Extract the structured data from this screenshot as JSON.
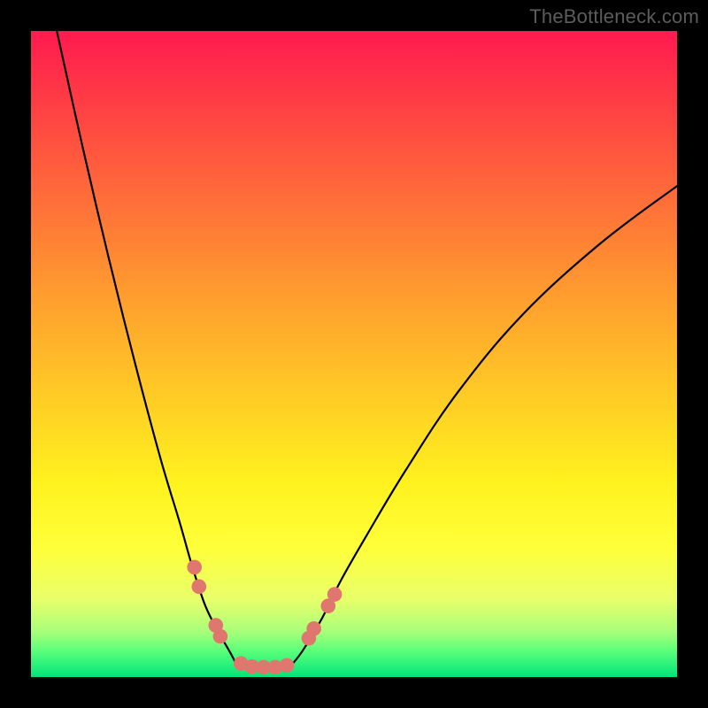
{
  "watermark": "TheBottleneck.com",
  "chart_data": {
    "type": "line",
    "title": "",
    "xlabel": "",
    "ylabel": "",
    "xlim": [
      0,
      100
    ],
    "ylim": [
      0,
      100
    ],
    "grid": false,
    "legend": false,
    "background_gradient": {
      "orientation": "vertical",
      "stops": [
        {
          "pos": 0.0,
          "color": "#ff1a4f"
        },
        {
          "pos": 0.25,
          "color": "#ff6a3a"
        },
        {
          "pos": 0.55,
          "color": "#ffc726"
        },
        {
          "pos": 0.8,
          "color": "#ffff3a"
        },
        {
          "pos": 0.93,
          "color": "#a8ff7a"
        },
        {
          "pos": 1.0,
          "color": "#00e57a"
        }
      ]
    },
    "series": [
      {
        "name": "left_curve",
        "x": [
          4,
          8,
          12,
          16,
          20,
          23,
          25,
          27,
          29,
          31,
          32
        ],
        "y": [
          100,
          82,
          65,
          49,
          34,
          24,
          17,
          11,
          7,
          3.5,
          1.5
        ]
      },
      {
        "name": "right_curve",
        "x": [
          40,
          42,
          45,
          48,
          52,
          58,
          66,
          76,
          88,
          100
        ],
        "y": [
          1.5,
          4,
          9,
          15,
          22,
          32,
          44,
          56,
          67,
          76
        ]
      }
    ],
    "markers": [
      {
        "cx": 25.3,
        "cy": 17.0,
        "r": 1.2,
        "color": "#e0776e"
      },
      {
        "cx": 26.0,
        "cy": 14.0,
        "r": 1.2,
        "color": "#e0776e"
      },
      {
        "cx": 28.6,
        "cy": 8.0,
        "r": 1.2,
        "color": "#e0776e"
      },
      {
        "cx": 29.3,
        "cy": 6.3,
        "r": 1.2,
        "color": "#e0776e"
      },
      {
        "cx": 32.5,
        "cy": 2.1,
        "r": 1.2,
        "color": "#e0776e"
      },
      {
        "cx": 34.2,
        "cy": 1.6,
        "r": 1.2,
        "color": "#e0776e"
      },
      {
        "cx": 36.0,
        "cy": 1.5,
        "r": 1.2,
        "color": "#e0776e"
      },
      {
        "cx": 37.8,
        "cy": 1.5,
        "r": 1.2,
        "color": "#e0776e"
      },
      {
        "cx": 39.6,
        "cy": 1.8,
        "r": 1.2,
        "color": "#e0776e"
      },
      {
        "cx": 43.0,
        "cy": 6.0,
        "r": 1.2,
        "color": "#e0776e"
      },
      {
        "cx": 43.8,
        "cy": 7.5,
        "r": 1.2,
        "color": "#e0776e"
      },
      {
        "cx": 46.0,
        "cy": 11.0,
        "r": 1.2,
        "color": "#e0776e"
      },
      {
        "cx": 47.0,
        "cy": 12.8,
        "r": 1.2,
        "color": "#e0776e"
      }
    ]
  }
}
